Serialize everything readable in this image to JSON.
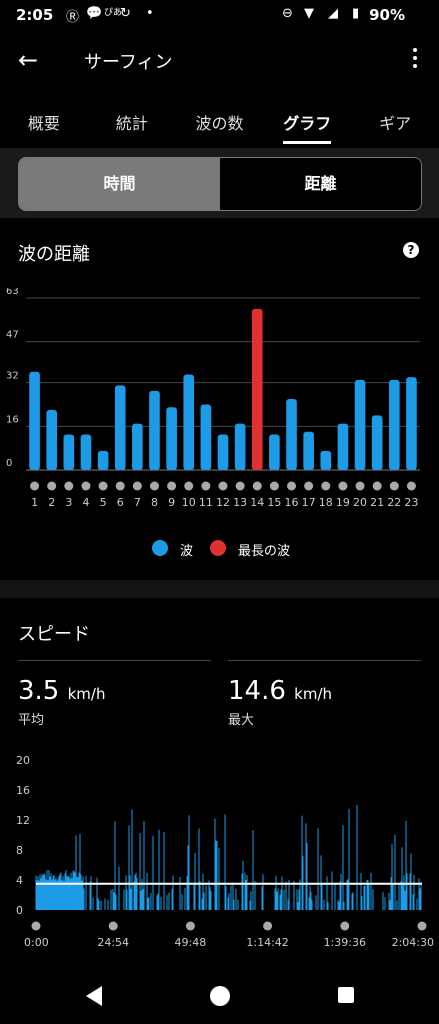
{
  "status": {
    "time": "2:05",
    "battery": "90%",
    "icons": [
      "r-icon",
      "chat-icon",
      "ticket-pia-icon",
      "sync-icon",
      "dot-icon",
      "dnd-icon",
      "wifi-icon",
      "signal-icon",
      "battery-icon"
    ]
  },
  "app_bar": {
    "title": "サーフィン",
    "back_icon": "arrow-left-icon",
    "menu_icon": "more-vert-icon"
  },
  "tabs": [
    {
      "label": "概要"
    },
    {
      "label": "統計"
    },
    {
      "label": "波の数"
    },
    {
      "label": "グラフ",
      "active": true
    },
    {
      "label": "ギア"
    }
  ],
  "segment": {
    "time_label": "時間",
    "distance_label": "距離",
    "selected": "時間"
  },
  "wave_distance": {
    "title": "波の距離",
    "help_icon": "help-icon",
    "legend": {
      "wave": "波",
      "longest": "最長の波"
    },
    "colors": {
      "wave": "#1e9be6",
      "longest": "#e03131"
    }
  },
  "speed": {
    "title": "スピード",
    "avg": {
      "value": "3.5",
      "unit": "km/h",
      "label": "平均"
    },
    "max": {
      "value": "14.6",
      "unit": "km/h",
      "label": "最大"
    }
  },
  "chart_data": [
    {
      "type": "bar",
      "categories": [
        "1",
        "2",
        "3",
        "4",
        "5",
        "6",
        "7",
        "8",
        "9",
        "10",
        "11",
        "12",
        "13",
        "14",
        "15",
        "16",
        "17",
        "18",
        "19",
        "20",
        "21",
        "22",
        "23"
      ],
      "series": [
        {
          "name": "波",
          "values": [
            36,
            22,
            13,
            13,
            7,
            31,
            17,
            29,
            23,
            35,
            24,
            13,
            17,
            null,
            13,
            26,
            14,
            7,
            17,
            33,
            20,
            33,
            34
          ]
        },
        {
          "name": "最長の波",
          "values": [
            null,
            null,
            null,
            null,
            null,
            null,
            null,
            null,
            null,
            null,
            null,
            null,
            null,
            59,
            null,
            null,
            null,
            null,
            null,
            null,
            null,
            null,
            null
          ]
        }
      ],
      "yticks": [
        0,
        16,
        32,
        47,
        63
      ],
      "ylim": [
        0,
        63
      ],
      "grid": true
    },
    {
      "type": "area",
      "xticks": [
        "0:00",
        "24:54",
        "49:48",
        "1:14:42",
        "1:39:36",
        "2:04:30"
      ],
      "yticks": [
        0,
        4,
        8,
        12,
        16,
        20
      ],
      "ylim": [
        0,
        20
      ],
      "average": 3.5,
      "grid": false
    }
  ]
}
